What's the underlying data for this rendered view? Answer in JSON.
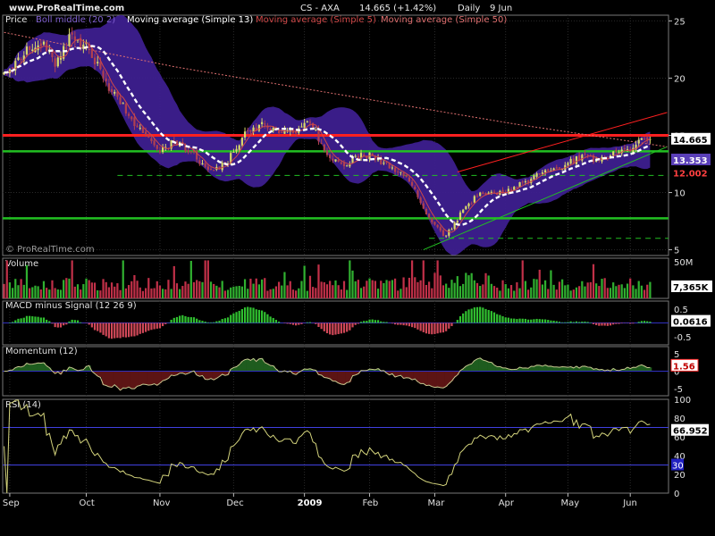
{
  "header": {
    "site": "www.ProRealTime.com",
    "instrument": "CS - AXA",
    "price_change": "14.665 (+1.42%)",
    "period": "Daily",
    "date": "9 Jun"
  },
  "colors": {
    "background": "#000000",
    "grid": "#2a2a2a",
    "panel_border": "#777777",
    "bollinger_band": "#3d1f8f",
    "candle_up": "#d8d86a",
    "candle_down": "#b04050",
    "sma13": "#ffffff",
    "sma5": "#d04848",
    "sma50": "#e07070",
    "resistance": "#ff2020",
    "support": "#22c022",
    "volume_up": "#30b030",
    "volume_down": "#c03048",
    "macd_up": "#30c030",
    "macd_down": "#d04858",
    "momentum_line": "#c8c890",
    "momentum_fill_pos": "#1e5c1e",
    "momentum_fill_neg": "#5c1414",
    "rsi_line": "#d4d47c",
    "rsi_level": "#4040e0",
    "zero_line": "#3030c0"
  },
  "chart_data": [
    {
      "type": "candlestick",
      "panel": "price",
      "legend": [
        "Price",
        "Boll middle (20 2)",
        "Moving average (Simple 13)",
        "Moving average (Simple 5)",
        "Moving average (Simple 50)"
      ],
      "watermark": "© ProRealTime.com",
      "x_labels": [
        "Sep",
        "Oct",
        "Nov",
        "Dec",
        "2009",
        "Feb",
        "Mar",
        "Apr",
        "May",
        "Jun"
      ],
      "x_label_days": [
        2,
        29,
        55,
        81,
        106,
        129,
        152,
        177,
        199,
        221
      ],
      "n_days": 235,
      "ylim": [
        4.5,
        25.5
      ],
      "y_ticks": [
        5,
        10,
        15,
        20,
        25
      ],
      "y_tick_labels": [
        "5",
        "10",
        "15",
        "20",
        "25"
      ],
      "price_anchors": [
        [
          0,
          20.5
        ],
        [
          5,
          21.8
        ],
        [
          10,
          22.5
        ],
        [
          14,
          23.2
        ],
        [
          18,
          21.0
        ],
        [
          24,
          23.8
        ],
        [
          30,
          22.6
        ],
        [
          34,
          20.8
        ],
        [
          38,
          18.8
        ],
        [
          44,
          16.7
        ],
        [
          50,
          15.0
        ],
        [
          55,
          13.5
        ],
        [
          60,
          14.4
        ],
        [
          66,
          13.6
        ],
        [
          72,
          12.0
        ],
        [
          78,
          12.4
        ],
        [
          84,
          14.8
        ],
        [
          90,
          15.9
        ],
        [
          96,
          15.4
        ],
        [
          102,
          15.2
        ],
        [
          108,
          16.1
        ],
        [
          112,
          14.3
        ],
        [
          116,
          12.8
        ],
        [
          120,
          12.3
        ],
        [
          124,
          13.2
        ],
        [
          130,
          13.2
        ],
        [
          134,
          12.6
        ],
        [
          140,
          11.8
        ],
        [
          144,
          10.6
        ],
        [
          148,
          8.6
        ],
        [
          152,
          7.2
        ],
        [
          155,
          6.2
        ],
        [
          158,
          6.8
        ],
        [
          162,
          8.5
        ],
        [
          168,
          10.0
        ],
        [
          174,
          9.8
        ],
        [
          180,
          10.5
        ],
        [
          186,
          11.2
        ],
        [
          192,
          11.9
        ],
        [
          198,
          12.4
        ],
        [
          204,
          13.3
        ],
        [
          210,
          12.8
        ],
        [
          216,
          13.6
        ],
        [
          222,
          13.9
        ],
        [
          226,
          14.7
        ],
        [
          228,
          14.665
        ]
      ],
      "last_price": 14.665,
      "last_price_label": "14.665",
      "bollinger_upper_label": "13.353",
      "bollinger_lower_label": "12.002",
      "bollinger_upper_value": 13.353,
      "bollinger_lower_value": 12.002,
      "resistance_line": 15.0,
      "support_lines": [
        13.6,
        7.75
      ],
      "dashed_support_lines": [
        {
          "value": 11.5,
          "from_day": 40,
          "to_day": 235
        },
        {
          "value": 6.0,
          "from_day": 150,
          "to_day": 235
        }
      ],
      "trend_channel": {
        "lower": [
          [
            148,
            5.0
          ],
          [
            234,
            14.0
          ]
        ],
        "upper": [
          [
            160,
            11.8
          ],
          [
            234,
            17.0
          ]
        ]
      },
      "sma50_approx": [
        [
          0,
          24.0
        ],
        [
          60,
          21.0
        ],
        [
          120,
          18.5
        ],
        [
          180,
          16.0
        ],
        [
          234,
          14.0
        ]
      ]
    },
    {
      "type": "bar",
      "panel": "volume",
      "title": "Volume",
      "y_tick_labels": [
        "50M"
      ],
      "last_value_label": "7,365K",
      "ylim": [
        0,
        55
      ]
    },
    {
      "type": "bar",
      "panel": "macd",
      "title": "MACD minus Signal (12 26 9)",
      "y_ticks": [
        0.5,
        0,
        -0.5
      ],
      "y_tick_labels": [
        "0.5",
        "0",
        "-0.5"
      ],
      "ylim": [
        -0.8,
        0.8
      ],
      "last_value_label": "0.0616",
      "last_value": 0.0616
    },
    {
      "type": "area",
      "panel": "momentum",
      "title": "Momentum (12)",
      "y_ticks": [
        5,
        0,
        -5
      ],
      "y_tick_labels": [
        "5",
        "0",
        "-5"
      ],
      "ylim": [
        -7,
        7
      ],
      "last_value_label": "1.56",
      "last_value": 1.56
    },
    {
      "type": "line",
      "panel": "rsi",
      "title": "RSI (14)",
      "y_ticks": [
        100,
        80,
        60,
        40,
        20,
        0
      ],
      "y_tick_labels": [
        "100",
        "80",
        "60",
        "40",
        "20",
        "0"
      ],
      "ylim": [
        0,
        100
      ],
      "levels": [
        70,
        30
      ],
      "level_labels": [
        "",
        "30"
      ],
      "last_value_label": "66.952",
      "last_value": 66.952
    }
  ]
}
